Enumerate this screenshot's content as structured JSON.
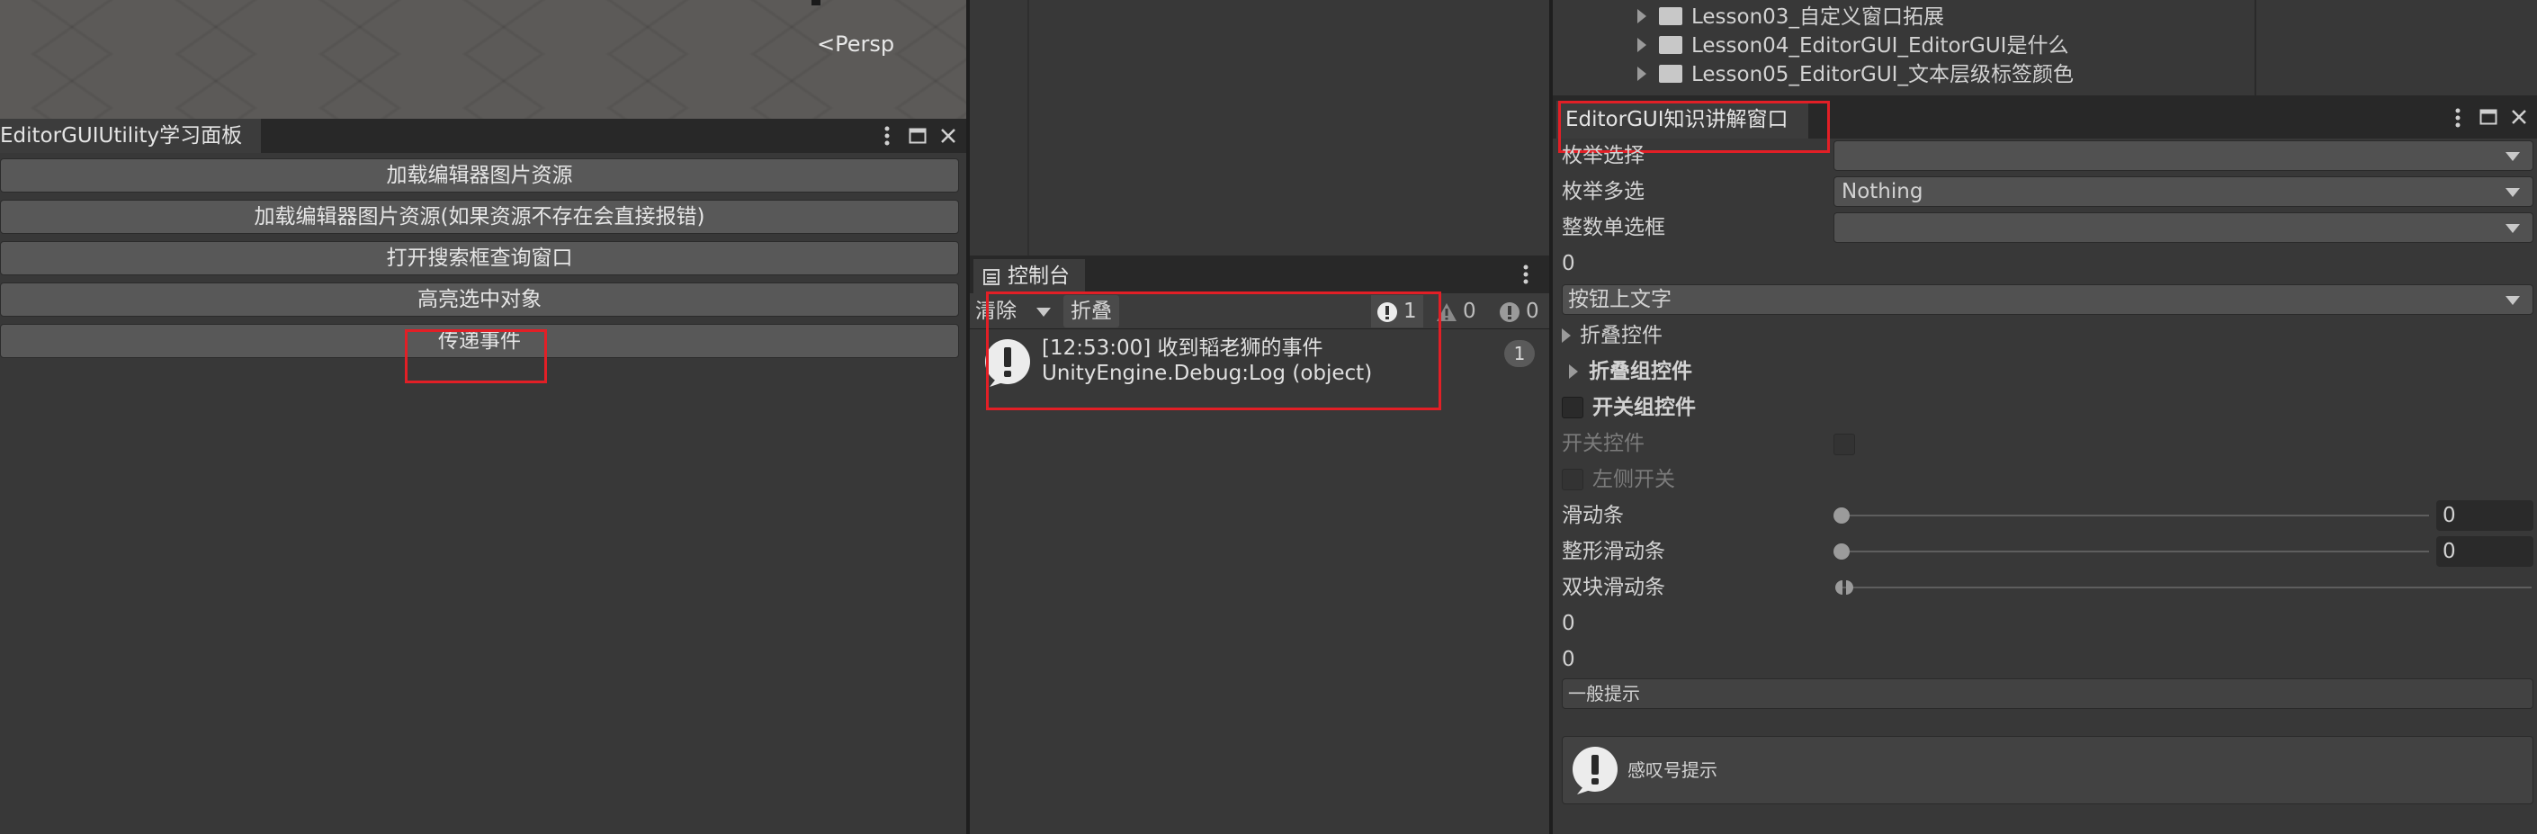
{
  "scene": {
    "persp_label": "Persp"
  },
  "utility_window": {
    "title": "EditorGUIUtility学习面板",
    "buttons": [
      "加载编辑器图片资源",
      "加载编辑器图片资源(如果资源不存在会直接报错)",
      "打开搜索框查询窗口",
      "高亮选中对象",
      "传递事件"
    ]
  },
  "console": {
    "title": "控制台",
    "clear_label": "清除",
    "collapse_label": "折叠",
    "log_count": "1",
    "warn_count": "0",
    "error_count": "0",
    "entries": [
      {
        "line1": "[12:53:00] 收到韬老狮的事件",
        "line2": "UnityEngine.Debug:Log (object)",
        "count": "1"
      }
    ]
  },
  "project": {
    "folders": [
      "Lesson03_自定义窗口拓展",
      "Lesson04_EditorGUI_EditorGUI是什么",
      "Lesson05_EditorGUI_文本层级标签颜色"
    ]
  },
  "editorgui_window": {
    "title": "EditorGUI知识讲解窗口",
    "enum_popup_label": "枚举选择",
    "enum_mask_label": "枚举多选",
    "enum_mask_value": "Nothing",
    "int_popup_label": "整数单选框",
    "int_value": "0",
    "dropdown_button_text": "按钮上文字",
    "foldout_label": "折叠控件",
    "foldout_group_label": "折叠组控件",
    "toggle_group_label": "开关组控件",
    "toggle_label": "开关控件",
    "toggle_left_label": "左侧开关",
    "slider_label": "滑动条",
    "slider_value": "0",
    "int_slider_label": "整形滑动条",
    "int_slider_value": "0",
    "minmax_label": "双块滑动条",
    "minmax_min": "0",
    "minmax_max": "0",
    "helpbox_normal": "一般提示",
    "helpbox_warning": "感叹号提示"
  }
}
